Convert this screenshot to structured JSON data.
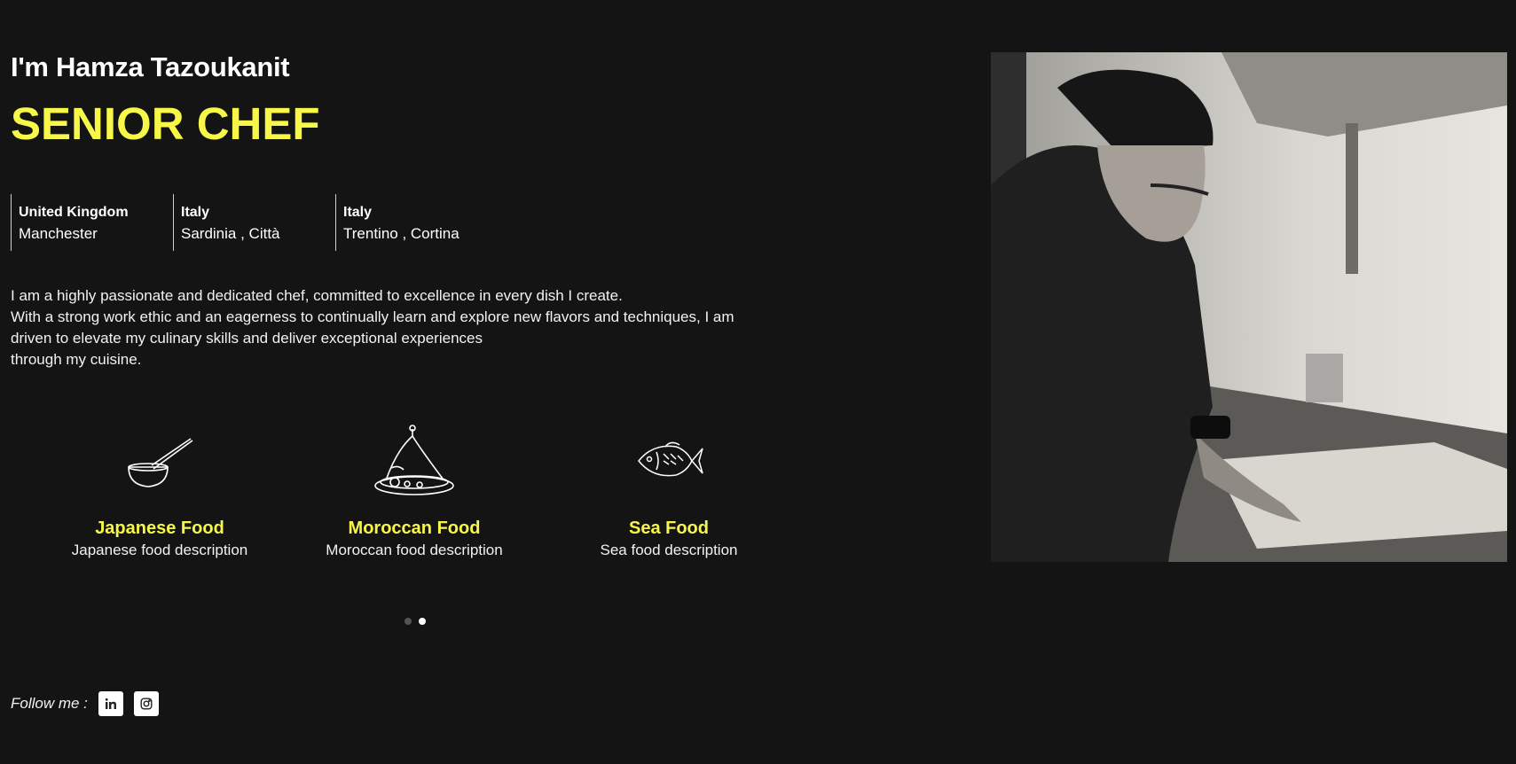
{
  "hero": {
    "greeting": "I'm Hamza Tazoukanit",
    "role": "SENIOR CHEF"
  },
  "locations": [
    {
      "country": "United Kingdom",
      "city": "Manchester"
    },
    {
      "country": "Italy",
      "city": "Sardinia , Città"
    },
    {
      "country": "Italy",
      "city": "Trentino , Cortina"
    }
  ],
  "bio": {
    "line1": "I am a highly passionate and dedicated chef, committed to excellence in every dish I create.",
    "line2": "With a strong work ethic and an eagerness to continually learn and explore new flavors and techniques, I am driven to elevate my culinary skills and deliver exceptional experiences",
    "line3": "through my cuisine."
  },
  "cuisines": [
    {
      "title": "Japanese Food",
      "description": "Japanese food description",
      "icon": "bowl-chopsticks-icon"
    },
    {
      "title": "Moroccan Food",
      "description": "Moroccan food description",
      "icon": "tagine-icon"
    },
    {
      "title": "Sea Food",
      "description": "Sea food description",
      "icon": "fish-icon"
    }
  ],
  "carousel": {
    "page_count": 2,
    "active_index": 1
  },
  "social": {
    "label": "Follow me :",
    "links": [
      {
        "icon": "linkedin-icon"
      },
      {
        "icon": "instagram-icon"
      }
    ]
  },
  "photo": {
    "description_icon": "chef-portrait-photo"
  },
  "colors": {
    "background": "#141414",
    "accent": "#f7f74a",
    "text": "#ffffff"
  }
}
